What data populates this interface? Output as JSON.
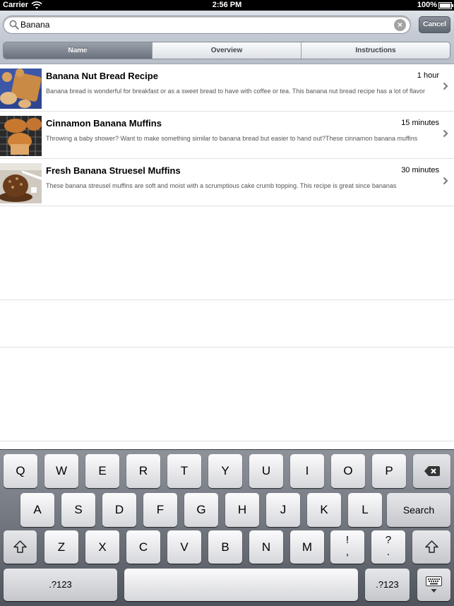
{
  "status_bar": {
    "carrier": "Carrier",
    "time": "2:56 PM",
    "battery": "100%"
  },
  "search": {
    "value": "Banana",
    "placeholder": "",
    "cancel_label": "Cancel"
  },
  "segments": [
    {
      "label": "Name",
      "selected": true
    },
    {
      "label": "Overview",
      "selected": false
    },
    {
      "label": "Instructions",
      "selected": false
    }
  ],
  "recipes": [
    {
      "title": "Banana Nut Bread Recipe",
      "time": "1 hour",
      "description": "Banana bread is wonderful for breakfast or as a sweet bread to have with coffee or tea. This banana nut bread recipe has a lot of flavor"
    },
    {
      "title": "Cinnamon Banana Muffins",
      "time": "15 minutes",
      "description": "Throwing a baby shower? Want to make something similar to banana bread but easier to hand out?These cinnamon banana muffins"
    },
    {
      "title": "Fresh Banana Struesel Muffins",
      "time": "30 minutes",
      "description": "These banana streusel muffins are soft and moist with a scrumptious cake crumb topping. This recipe is great since bananas"
    }
  ],
  "keyboard": {
    "row1": [
      "Q",
      "W",
      "E",
      "R",
      "T",
      "Y",
      "U",
      "I",
      "O",
      "P"
    ],
    "row2": [
      "A",
      "S",
      "D",
      "F",
      "G",
      "H",
      "J",
      "K",
      "L"
    ],
    "row3": [
      "Z",
      "X",
      "C",
      "V",
      "B",
      "N",
      "M"
    ],
    "punct1": {
      "top": "!",
      "bottom": ","
    },
    "punct2": {
      "top": "?",
      "bottom": "."
    },
    "search_label": "Search",
    "numbers_label": ".?123"
  }
}
